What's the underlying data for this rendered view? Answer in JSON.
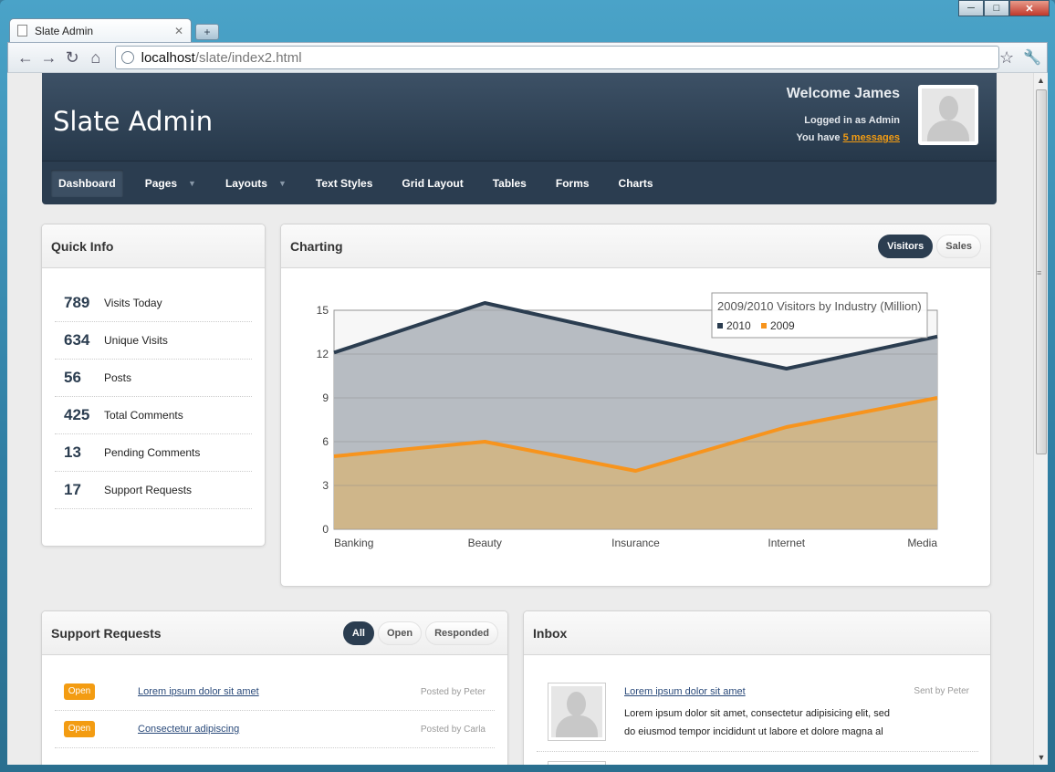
{
  "browser": {
    "tab_title": "Slate Admin",
    "url_host": "localhost",
    "url_path": "/slate/index2.html"
  },
  "header": {
    "title": "Slate Admin",
    "welcome": "Welcome James",
    "logged_in": "Logged in as Admin",
    "you_have": "You have",
    "messages_link": "5 messages"
  },
  "nav": [
    {
      "label": "Dashboard"
    },
    {
      "label": "Pages"
    },
    {
      "label": "Layouts"
    },
    {
      "label": "Text Styles"
    },
    {
      "label": "Grid Layout"
    },
    {
      "label": "Tables"
    },
    {
      "label": "Forms"
    },
    {
      "label": "Charts"
    }
  ],
  "quick_info": {
    "title": "Quick Info",
    "items": [
      {
        "value": "789",
        "label": "Visits Today"
      },
      {
        "value": "634",
        "label": "Unique Visits"
      },
      {
        "value": "56",
        "label": "Posts"
      },
      {
        "value": "425",
        "label": "Total Comments"
      },
      {
        "value": "13",
        "label": "Pending Comments"
      },
      {
        "value": "17",
        "label": "Support Requests"
      }
    ]
  },
  "charting": {
    "title": "Charting",
    "tabs": [
      "Visitors",
      "Sales"
    ]
  },
  "chart_data": {
    "type": "area",
    "title": "2009/2010 Visitors by Industry (Million)",
    "categories": [
      "Banking",
      "Beauty",
      "Insurance",
      "Internet",
      "Media"
    ],
    "series": [
      {
        "name": "2010",
        "values": [
          12.1,
          15.5,
          13.2,
          11.0,
          13.2
        ],
        "color": "#2b3d50"
      },
      {
        "name": "2009",
        "values": [
          5.0,
          6.0,
          4.0,
          7.0,
          9.0
        ],
        "color": "#f7941d"
      }
    ],
    "ylim": [
      0,
      15
    ],
    "yticks": [
      0,
      3,
      6,
      9,
      12,
      15
    ],
    "grid": true,
    "legend": "top-right"
  },
  "support": {
    "title": "Support Requests",
    "tabs": [
      "All",
      "Open",
      "Responded"
    ],
    "rows": [
      {
        "status": "Open",
        "title": "Lorem ipsum dolor sit amet",
        "by": "Posted by Peter"
      },
      {
        "status": "Open",
        "title": "Consectetur adipiscing",
        "by": "Posted by Carla"
      }
    ]
  },
  "inbox": {
    "title": "Inbox",
    "item": {
      "title": "Lorem ipsum dolor sit amet",
      "by": "Sent by Peter",
      "text": "Lorem ipsum dolor sit amet, consectetur adipisicing elit, sed do eiusmod tempor incididunt ut labore et dolore magna al"
    }
  }
}
